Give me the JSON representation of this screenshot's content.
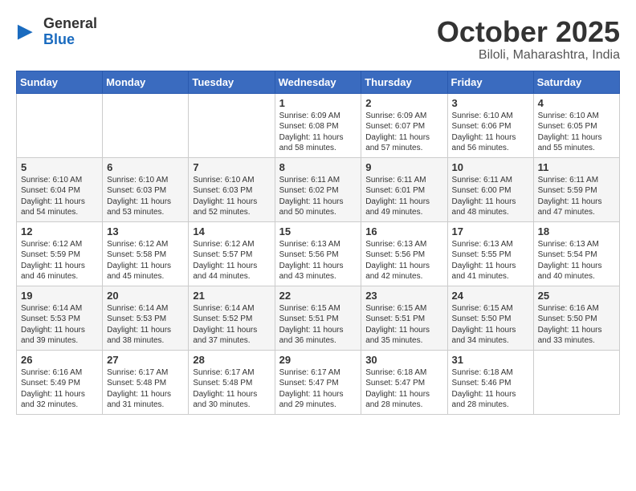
{
  "header": {
    "logo_general": "General",
    "logo_blue": "Blue",
    "month": "October 2025",
    "location": "Biloli, Maharashtra, India"
  },
  "weekdays": [
    "Sunday",
    "Monday",
    "Tuesday",
    "Wednesday",
    "Thursday",
    "Friday",
    "Saturday"
  ],
  "weeks": [
    [
      {
        "day": "",
        "text": ""
      },
      {
        "day": "",
        "text": ""
      },
      {
        "day": "",
        "text": ""
      },
      {
        "day": "1",
        "text": "Sunrise: 6:09 AM\nSunset: 6:08 PM\nDaylight: 11 hours and 58 minutes."
      },
      {
        "day": "2",
        "text": "Sunrise: 6:09 AM\nSunset: 6:07 PM\nDaylight: 11 hours and 57 minutes."
      },
      {
        "day": "3",
        "text": "Sunrise: 6:10 AM\nSunset: 6:06 PM\nDaylight: 11 hours and 56 minutes."
      },
      {
        "day": "4",
        "text": "Sunrise: 6:10 AM\nSunset: 6:05 PM\nDaylight: 11 hours and 55 minutes."
      }
    ],
    [
      {
        "day": "5",
        "text": "Sunrise: 6:10 AM\nSunset: 6:04 PM\nDaylight: 11 hours and 54 minutes."
      },
      {
        "day": "6",
        "text": "Sunrise: 6:10 AM\nSunset: 6:03 PM\nDaylight: 11 hours and 53 minutes."
      },
      {
        "day": "7",
        "text": "Sunrise: 6:10 AM\nSunset: 6:03 PM\nDaylight: 11 hours and 52 minutes."
      },
      {
        "day": "8",
        "text": "Sunrise: 6:11 AM\nSunset: 6:02 PM\nDaylight: 11 hours and 50 minutes."
      },
      {
        "day": "9",
        "text": "Sunrise: 6:11 AM\nSunset: 6:01 PM\nDaylight: 11 hours and 49 minutes."
      },
      {
        "day": "10",
        "text": "Sunrise: 6:11 AM\nSunset: 6:00 PM\nDaylight: 11 hours and 48 minutes."
      },
      {
        "day": "11",
        "text": "Sunrise: 6:11 AM\nSunset: 5:59 PM\nDaylight: 11 hours and 47 minutes."
      }
    ],
    [
      {
        "day": "12",
        "text": "Sunrise: 6:12 AM\nSunset: 5:59 PM\nDaylight: 11 hours and 46 minutes."
      },
      {
        "day": "13",
        "text": "Sunrise: 6:12 AM\nSunset: 5:58 PM\nDaylight: 11 hours and 45 minutes."
      },
      {
        "day": "14",
        "text": "Sunrise: 6:12 AM\nSunset: 5:57 PM\nDaylight: 11 hours and 44 minutes."
      },
      {
        "day": "15",
        "text": "Sunrise: 6:13 AM\nSunset: 5:56 PM\nDaylight: 11 hours and 43 minutes."
      },
      {
        "day": "16",
        "text": "Sunrise: 6:13 AM\nSunset: 5:56 PM\nDaylight: 11 hours and 42 minutes."
      },
      {
        "day": "17",
        "text": "Sunrise: 6:13 AM\nSunset: 5:55 PM\nDaylight: 11 hours and 41 minutes."
      },
      {
        "day": "18",
        "text": "Sunrise: 6:13 AM\nSunset: 5:54 PM\nDaylight: 11 hours and 40 minutes."
      }
    ],
    [
      {
        "day": "19",
        "text": "Sunrise: 6:14 AM\nSunset: 5:53 PM\nDaylight: 11 hours and 39 minutes."
      },
      {
        "day": "20",
        "text": "Sunrise: 6:14 AM\nSunset: 5:53 PM\nDaylight: 11 hours and 38 minutes."
      },
      {
        "day": "21",
        "text": "Sunrise: 6:14 AM\nSunset: 5:52 PM\nDaylight: 11 hours and 37 minutes."
      },
      {
        "day": "22",
        "text": "Sunrise: 6:15 AM\nSunset: 5:51 PM\nDaylight: 11 hours and 36 minutes."
      },
      {
        "day": "23",
        "text": "Sunrise: 6:15 AM\nSunset: 5:51 PM\nDaylight: 11 hours and 35 minutes."
      },
      {
        "day": "24",
        "text": "Sunrise: 6:15 AM\nSunset: 5:50 PM\nDaylight: 11 hours and 34 minutes."
      },
      {
        "day": "25",
        "text": "Sunrise: 6:16 AM\nSunset: 5:50 PM\nDaylight: 11 hours and 33 minutes."
      }
    ],
    [
      {
        "day": "26",
        "text": "Sunrise: 6:16 AM\nSunset: 5:49 PM\nDaylight: 11 hours and 32 minutes."
      },
      {
        "day": "27",
        "text": "Sunrise: 6:17 AM\nSunset: 5:48 PM\nDaylight: 11 hours and 31 minutes."
      },
      {
        "day": "28",
        "text": "Sunrise: 6:17 AM\nSunset: 5:48 PM\nDaylight: 11 hours and 30 minutes."
      },
      {
        "day": "29",
        "text": "Sunrise: 6:17 AM\nSunset: 5:47 PM\nDaylight: 11 hours and 29 minutes."
      },
      {
        "day": "30",
        "text": "Sunrise: 6:18 AM\nSunset: 5:47 PM\nDaylight: 11 hours and 28 minutes."
      },
      {
        "day": "31",
        "text": "Sunrise: 6:18 AM\nSunset: 5:46 PM\nDaylight: 11 hours and 28 minutes."
      },
      {
        "day": "",
        "text": ""
      }
    ]
  ]
}
